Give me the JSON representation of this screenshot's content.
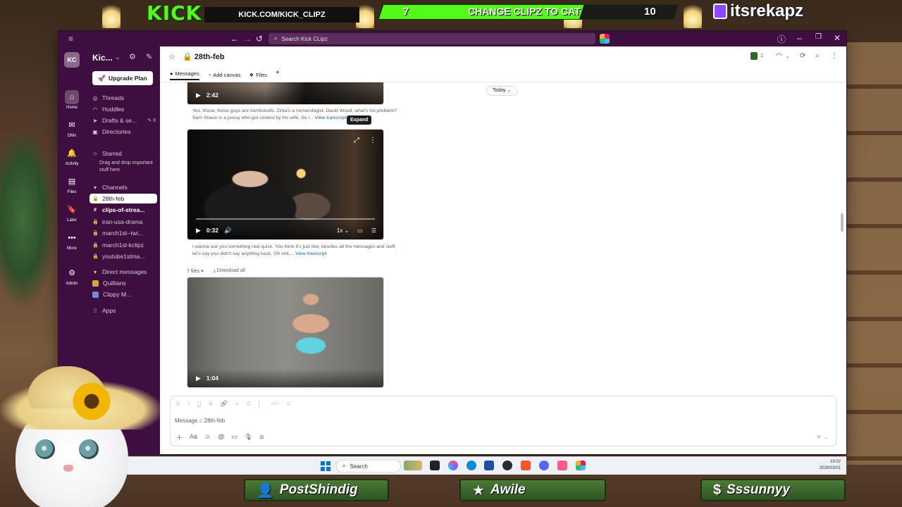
{
  "overlay": {
    "kick_logo": "KICK",
    "kick_url": "KICK.COM/KICK_CLIPZ",
    "goal_left": "7",
    "goal_text": "CHANGE CLIPZ TO CAT",
    "goal_right": "10",
    "goal_progress": 0.68,
    "twitch_handle": "itsrekapz",
    "bottom_pills": [
      {
        "label": "PostShindig",
        "icon": "person-icon"
      },
      {
        "label": "Awile",
        "icon": "star-icon"
      },
      {
        "label": "Sssunnyy",
        "icon": "dollar-icon"
      }
    ]
  },
  "titlebar": {
    "search_placeholder": "Search Kick CLipz"
  },
  "rail": {
    "workspace_initials": "KC",
    "items": [
      {
        "label": "Home",
        "icon": "home-icon",
        "glyph": "⌂"
      },
      {
        "label": "DMs",
        "icon": "dms-icon",
        "glyph": "✉"
      },
      {
        "label": "Activity",
        "icon": "bell-icon",
        "glyph": "🔔"
      },
      {
        "label": "Files",
        "icon": "files-icon",
        "glyph": "▤"
      },
      {
        "label": "Later",
        "icon": "bookmark-icon",
        "glyph": "🔖"
      },
      {
        "label": "More",
        "icon": "more-icon",
        "glyph": "•••"
      },
      {
        "label": "Admin",
        "icon": "gear-icon",
        "glyph": "⚙"
      }
    ]
  },
  "sidebar": {
    "workspace_name": "Kic...",
    "upgrade_label": "Upgrade Plan",
    "threads": "Threads",
    "huddles": "Huddles",
    "drafts": "Drafts & se...",
    "drafts_count": "8",
    "directories": "Directories",
    "starred": "Starred",
    "starred_note": "Drag and drop important stuff here",
    "channels_header": "Channels",
    "channels": [
      {
        "name": "28th-feb",
        "active": true,
        "bold": false
      },
      {
        "name": "clips-of-strea...",
        "active": false,
        "bold": true
      },
      {
        "name": "iran-usa-drama",
        "active": false,
        "bold": false
      },
      {
        "name": "march1st--twi...",
        "active": false,
        "bold": false
      },
      {
        "name": "march1st-kclipz",
        "active": false,
        "bold": false
      },
      {
        "name": "youtube1stma...",
        "active": false,
        "bold": false
      }
    ],
    "dm_header": "Direct messages",
    "dms": [
      {
        "name": "Quillians",
        "color": "#d9a441"
      },
      {
        "name": "Clippy M...",
        "color": "#6b8fd6"
      }
    ],
    "apps": "Apps"
  },
  "channel": {
    "title": "28th-feb",
    "member_count": "1",
    "tabs": [
      {
        "label": "Messages",
        "icon": "messages-icon",
        "active": true
      },
      {
        "label": "Add canvas",
        "icon": "canvas-icon",
        "active": false
      },
      {
        "label": "Files",
        "icon": "files-tab-icon",
        "active": false
      }
    ]
  },
  "messages": {
    "date_divider": "Today",
    "videos": [
      {
        "duration": "2:42"
      },
      {
        "duration": "0:32",
        "speed": "1x"
      },
      {
        "duration": "1:04"
      }
    ],
    "transcript_1": "Yes, those, those guys are numbskulls. Zirka's a numerologist. David Wood, what's his problem? Sam Shaun is a pussy who got cocked by his wife. So I...",
    "transcript_1_link": "View transcript",
    "transcript_2": "I wanna ask you something real quick. You think it's just like, besides all the messages and stuff, let's say you didn't say anything back. Oh shit,...",
    "transcript_2_link": "View transcript",
    "tooltip": "Expand",
    "files_count": "7 files",
    "download_all": "Download all"
  },
  "composer": {
    "placeholder": "Message ⌂ 28th-feb"
  },
  "taskbar": {
    "search": "Search",
    "time": "19:02",
    "date": "2026/03/01"
  }
}
